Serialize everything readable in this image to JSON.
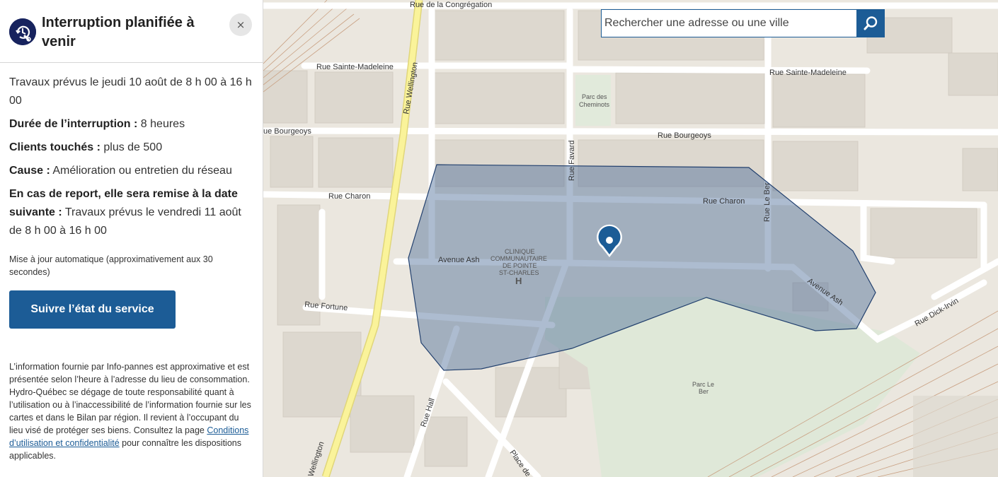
{
  "panel": {
    "title": "Interruption planifiée à venir",
    "close_label": "×",
    "status_icon": "clock-wrench-icon",
    "lines": [
      {
        "label": "",
        "value": "Travaux prévus le jeudi 10 août de 8 h 00 à 16 h 00"
      },
      {
        "label": "Durée de l’interruption :",
        "value": "8 heures"
      },
      {
        "label": "Clients touchés :",
        "value": "plus de 500"
      },
      {
        "label": "Cause :",
        "value": "Amélioration ou entretien du réseau"
      },
      {
        "label": "En cas de report, elle sera remise à la date suivante :",
        "value": "Travaux prévus le vendredi 11 août de 8 h 00 à 16 h 00"
      }
    ],
    "update_note": "Mise à jour automatique (approximativement aux 30 secondes)",
    "follow_button": "Suivre l’état du service",
    "disclaimer": {
      "text_before": "L’information fournie par Info-pannes est approximative et est présentée selon l’heure à l’adresse du lieu de consommation. Hydro-Québec se dégage de toute responsabilité quant à l’utilisation ou à l’inaccessibilité de l’information fournie sur les cartes et dans le Bilan par région. Il revient à l’occupant du lieu visé de protéger ses biens. Consultez la page ",
      "link": "Conditions d’utilisation et confidentialité",
      "text_after": " pour connaître les dispositions applicables."
    }
  },
  "search": {
    "placeholder": "Rechercher une adresse ou une ville",
    "button_icon": "search-icon"
  },
  "map": {
    "streets": {
      "congregation": "Rue de la Congrégation",
      "sainte_madeleine_left": "Rue Sainte-Madeleine",
      "sainte_madeleine_right": "Rue Sainte-Madeleine",
      "wellington_top": "Rue Wellington",
      "wellington_bottom": "Wellington",
      "bourgeoys_left": "ue Bourgeoys",
      "bourgeoys_right": "Rue Bourgeoys",
      "favard": "Rue Favard",
      "le_ber": "Rue Le Ber",
      "charon_left": "Rue Charon",
      "charon_right": "Rue Charon",
      "ash_left": "Avenue Ash",
      "ash_right": "Avenue Ash",
      "fortune": "Rue Fortune",
      "dick_irvin": "Rue Dick-Irvin",
      "hall": "Rue Hall",
      "place_de": "Place de"
    },
    "pois": {
      "parc_cheminots_1": "Parc des",
      "parc_cheminots_2": "Cheminots",
      "clinique_1": "CLINIQUE",
      "clinique_2": "COMMUNAUTAIRE",
      "clinique_3": "DE POINTE",
      "clinique_4": "ST-CHARLES",
      "hospital_symbol": "H",
      "parc_le_ber_1": "Parc Le",
      "parc_le_ber_2": "Ber"
    },
    "outage_marker_icon": "map-pin-icon",
    "colors": {
      "outage_fill": "#4a6a96",
      "outage_stroke": "#22406e",
      "marker": "#1c5c96",
      "main_road": "#faf39a"
    }
  }
}
